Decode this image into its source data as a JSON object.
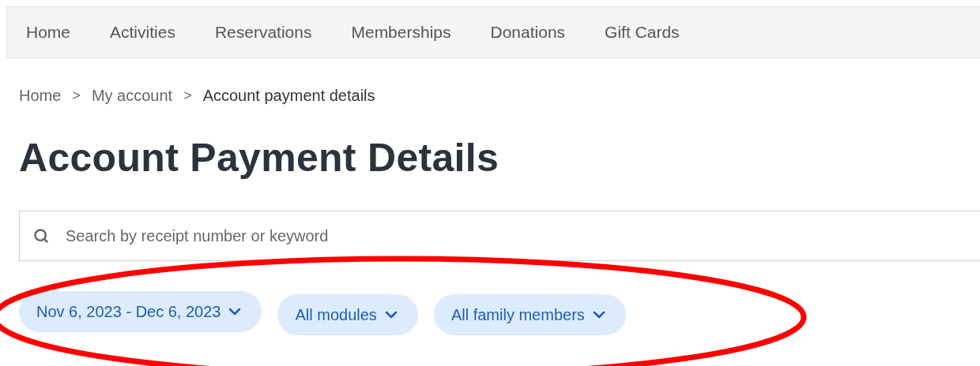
{
  "nav": {
    "items": [
      {
        "label": "Home"
      },
      {
        "label": "Activities"
      },
      {
        "label": "Reservations"
      },
      {
        "label": "Memberships"
      },
      {
        "label": "Donations"
      },
      {
        "label": "Gift Cards"
      }
    ]
  },
  "breadcrumb": [
    {
      "label": "Home",
      "kind": "link"
    },
    {
      "label": "My account",
      "kind": "link",
      "separator": ">"
    },
    {
      "label": "Account payment details",
      "kind": "current",
      "separator": ">"
    }
  ],
  "title": "Account Payment Details",
  "search": {
    "placeholder": "Search by receipt number or keyword"
  },
  "filters": [
    {
      "label": "Nov 6, 2023 - Dec 6, 2023"
    },
    {
      "label": "All modules"
    },
    {
      "label": "All family members"
    }
  ],
  "annotation": {
    "kind": "ellipse",
    "color": "#ff0000"
  }
}
